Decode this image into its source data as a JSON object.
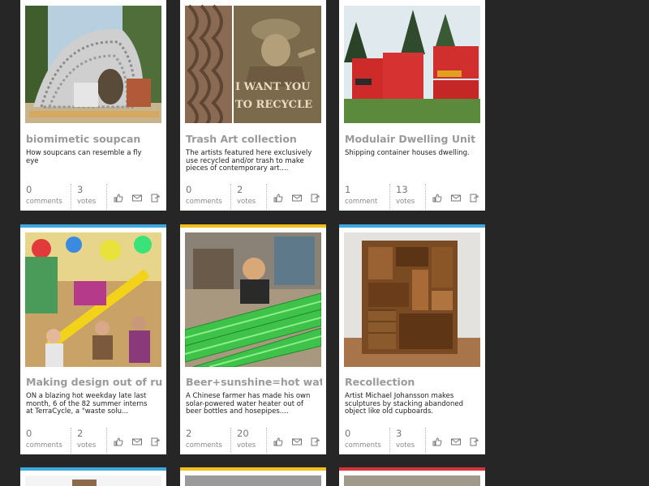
{
  "colors": {
    "background": "#262626",
    "accent_blue": "#3fa9dd",
    "accent_yellow": "#f3bf1d",
    "accent_red": "#d8333a"
  },
  "cards": [
    {
      "title": "biomimetic soupcan",
      "description": "How soupcans can resemble a fly eye",
      "comments": "0",
      "comments_label": "comments",
      "votes": "3",
      "votes_label": "votes",
      "accent": "none"
    },
    {
      "title": "Trash Art collection",
      "description": "The artists featured here exclusively use recycled and/or trash to make pieces of contemporary art....",
      "comments": "0",
      "comments_label": "comments",
      "votes": "2",
      "votes_label": "votes",
      "accent": "none",
      "image_text": [
        "I WANT YOU",
        "TO RECYCLE"
      ]
    },
    {
      "title": "Modulair Dwelling Unit",
      "description": "Shipping container houses dwelling.",
      "comments": "1",
      "comments_label": "comment",
      "votes": "13",
      "votes_label": "votes",
      "accent": "none"
    },
    {
      "title": "Making design out of rubbish",
      "description": "ON a blazing hot weekday late last month, 6 of the 82 summer interns at TerraCycle, a \"waste solu...",
      "comments": "0",
      "comments_label": "comments",
      "votes": "2",
      "votes_label": "votes",
      "accent": "blue"
    },
    {
      "title": "Beer+sunshine=hot water",
      "description": "A Chinese farmer has made his own solar-powered water heater out of beer bottles and hosepipes....",
      "comments": "2",
      "comments_label": "comments",
      "votes": "20",
      "votes_label": "votes",
      "accent": "yellow"
    },
    {
      "title": "Recollection",
      "description": "Artist Michael Johansson makes sculptures by stacking abandoned object like old cupboards.",
      "comments": "0",
      "comments_label": "comments",
      "votes": "3",
      "votes_label": "votes",
      "accent": "blue"
    },
    {
      "title": "",
      "description": "",
      "accent": "blue"
    },
    {
      "title": "",
      "description": "",
      "accent": "yellow"
    },
    {
      "title": "",
      "description": "",
      "accent": "red"
    }
  ],
  "action_icons": [
    "thumbs-up-icon",
    "email-icon",
    "share-icon"
  ]
}
